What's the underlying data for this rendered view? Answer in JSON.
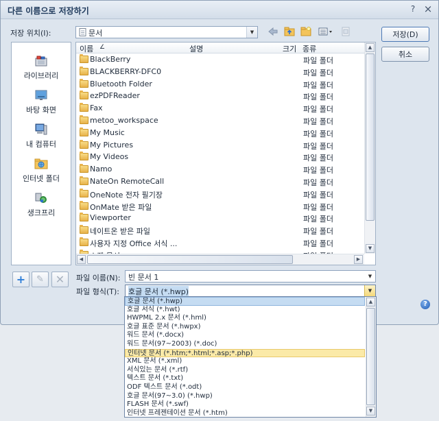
{
  "dialog": {
    "title": "다른 이름으로 저장하기",
    "help_icon_label": "?",
    "close_icon_label": "×"
  },
  "location": {
    "label": "저장 위치(I):",
    "value": "문서"
  },
  "places": [
    {
      "label": "라이브러리",
      "icon": "library-icon"
    },
    {
      "label": "바탕 화면",
      "icon": "desktop-icon"
    },
    {
      "label": "내 컴퓨터",
      "icon": "computer-icon"
    },
    {
      "label": "인터넷 폴더",
      "icon": "internet-folder-icon"
    },
    {
      "label": "생크프리",
      "icon": "sync-icon"
    }
  ],
  "columns": {
    "name": "이름",
    "name_sort": "∠",
    "desc": "설명",
    "size": "크기",
    "type": "종류"
  },
  "files": [
    {
      "name": "BlackBerry",
      "type": "파일 폴더"
    },
    {
      "name": "BLACKBERRY-DFC0",
      "type": "파일 폴더"
    },
    {
      "name": "Bluetooth Folder",
      "type": "파일 폴더"
    },
    {
      "name": "ezPDFReader",
      "type": "파일 폴더"
    },
    {
      "name": "Fax",
      "type": "파일 폴더"
    },
    {
      "name": "metoo_workspace",
      "type": "파일 폴더"
    },
    {
      "name": "My Music",
      "type": "파일 폴더"
    },
    {
      "name": "My Pictures",
      "type": "파일 폴더"
    },
    {
      "name": "My Videos",
      "type": "파일 폴더"
    },
    {
      "name": "Namo",
      "type": "파일 폴더"
    },
    {
      "name": "NateOn RemoteCall",
      "type": "파일 폴더"
    },
    {
      "name": "OneNote 전자 필기장",
      "type": "파일 폴더"
    },
    {
      "name": "OnMate 받은 파일",
      "type": "파일 폴더"
    },
    {
      "name": "Viewporter",
      "type": "파일 폴더"
    },
    {
      "name": "네이트온 받은 파일",
      "type": "파일 폴더"
    },
    {
      "name": "사용자 지정 Office 서식 ...",
      "type": "파일 폴더"
    },
    {
      "name": "스캔 문서",
      "type": "파일 폴더"
    }
  ],
  "filename": {
    "label": "파일 이름(N):",
    "value": "빈 문서 1"
  },
  "filetype": {
    "label": "파일 형식(T):",
    "value": "호글 문서 (*.hwp)",
    "options": [
      "호글 문서 (*.hwp)",
      "호글 서식 (*.hwt)",
      "HWPML 2.x 문서 (*.hml)",
      "호글 표준 문서 (*.hwpx)",
      "워드 문서 (*.docx)",
      "워드 문서(97~2003) (*.doc)",
      "인터넷 문서 (*.htm;*.html;*.asp;*.php)",
      "XML 문서 (*.xml)",
      "서식있는 문서 (*.rtf)",
      "텍스트 문서 (*.txt)",
      "ODF 텍스트 문서 (*.odt)",
      "호글 문서(97~3.0) (*.hwp)",
      "FLASH 문서 (*.swf)",
      "인터넷 프레젠테이션 문서 (*.htm)"
    ],
    "selected_index": 0,
    "hover_index": 6
  },
  "buttons": {
    "save": "저장(D)",
    "cancel": "취소"
  },
  "help_button": "?",
  "colors": {
    "dialog_bg": "#dde5ee",
    "selection": "#c5dcf2",
    "hover": "#fbeaa8",
    "title_text": "#1e395b"
  }
}
